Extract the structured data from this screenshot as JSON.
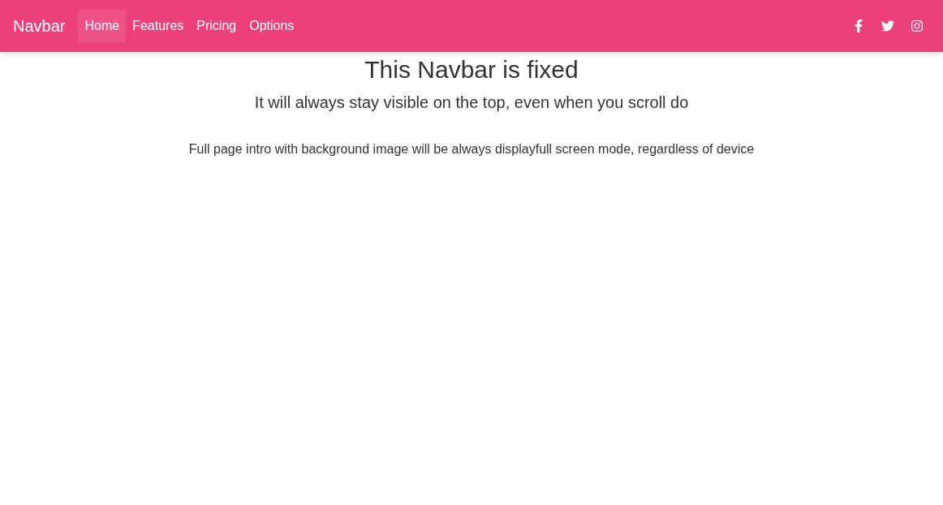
{
  "navbar": {
    "brand": "Navbar",
    "links": [
      {
        "label": "Home",
        "selected": true
      },
      {
        "label": "Features",
        "selected": false
      },
      {
        "label": "Pricing",
        "selected": false
      },
      {
        "label": "Options",
        "selected": false
      }
    ],
    "social": [
      {
        "kind": "facebook"
      },
      {
        "kind": "twitter"
      },
      {
        "kind": "instagram"
      }
    ]
  },
  "intro": {
    "title": "This Navbar is fixed",
    "subtitle": "It will always stay visible on the top, even when you scroll do",
    "text": "Full page intro with background image will be always displayfull screen mode, regardless of device"
  }
}
